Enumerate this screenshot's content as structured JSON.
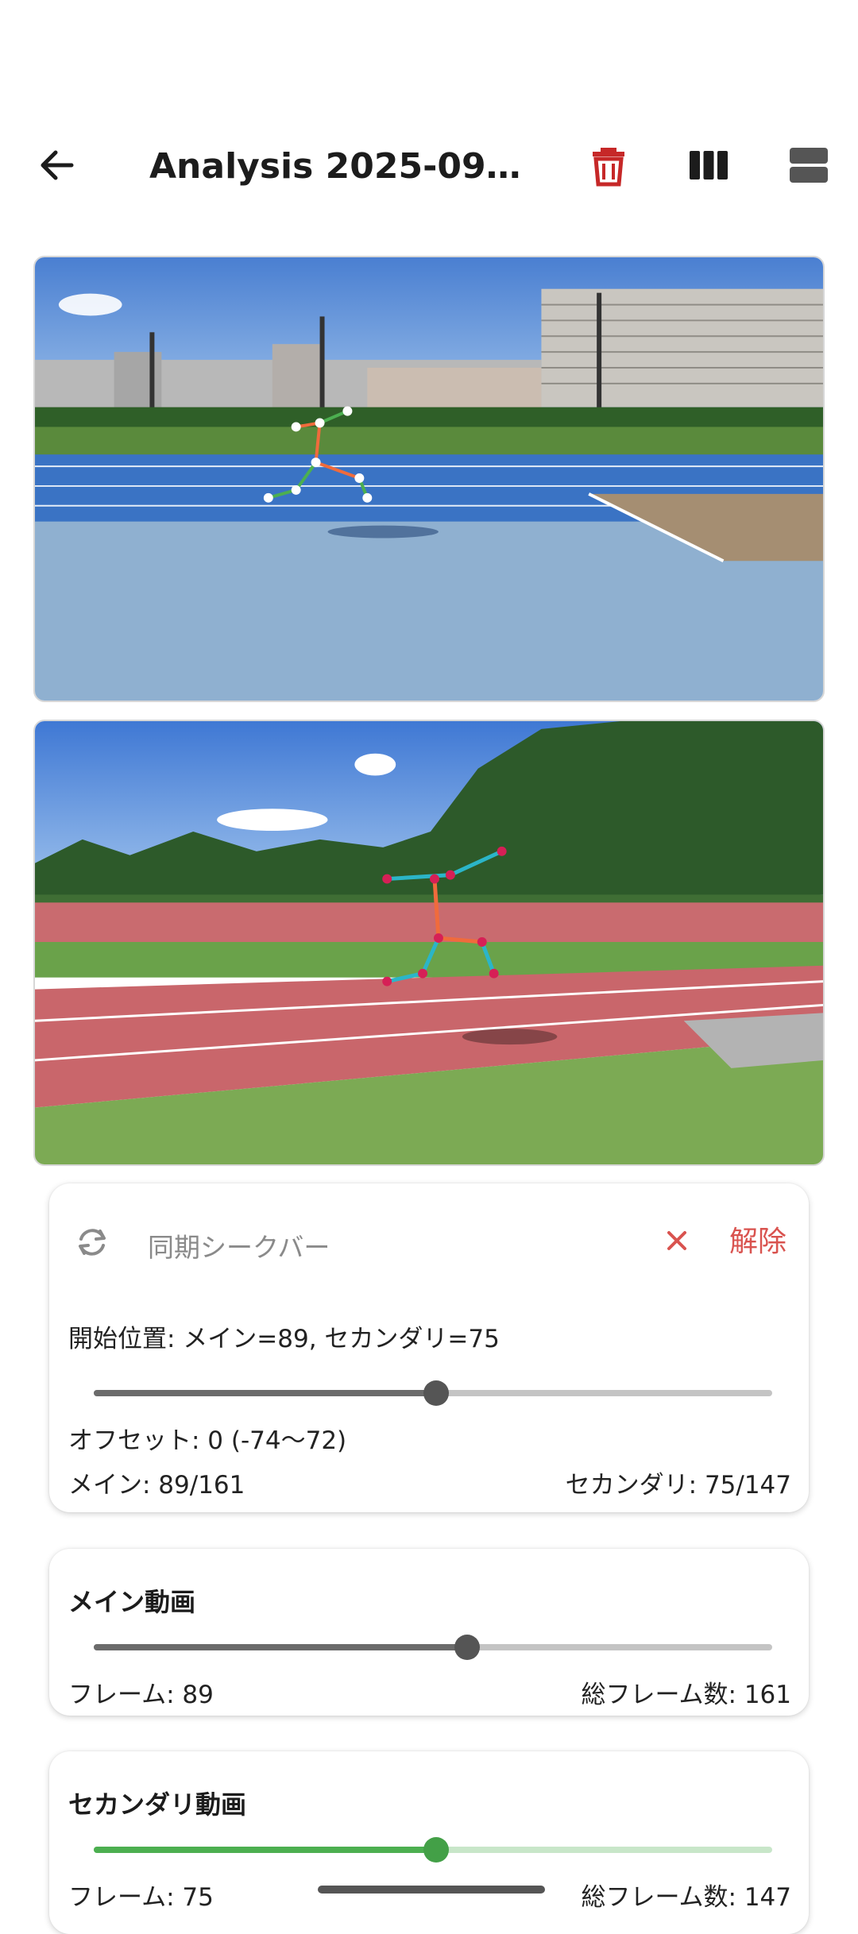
{
  "appbar": {
    "title": "Analysis 2025-09-1...",
    "icons": [
      "back-arrow-icon",
      "trash-icon",
      "columns-layout-icon",
      "rows-layout-icon"
    ],
    "trash_color": "#c62828"
  },
  "sync_card": {
    "title": "同期シークバー",
    "release_label": "解除",
    "start_position": "開始位置: メイン=89, セカンダリ=75",
    "offset": "オフセット: 0 (-74〜72)",
    "main_status": "メイン: 89/161",
    "secondary_status": "セカンダリ: 75/147",
    "slider_fraction": 0.505
  },
  "main_video_card": {
    "title": "メイン動画",
    "frame": "フレーム: 89",
    "total": "総フレーム数: 161",
    "slider_fraction": 0.55
  },
  "secondary_video_card": {
    "title": "セカンダリ動画",
    "frame": "フレーム: 75",
    "total": "総フレーム数: 147",
    "slider_fraction": 0.505
  },
  "colors": {
    "accent_red": "#d9534f",
    "slider_gray": "#6b6b6b",
    "slider_green": "#4caf50"
  }
}
